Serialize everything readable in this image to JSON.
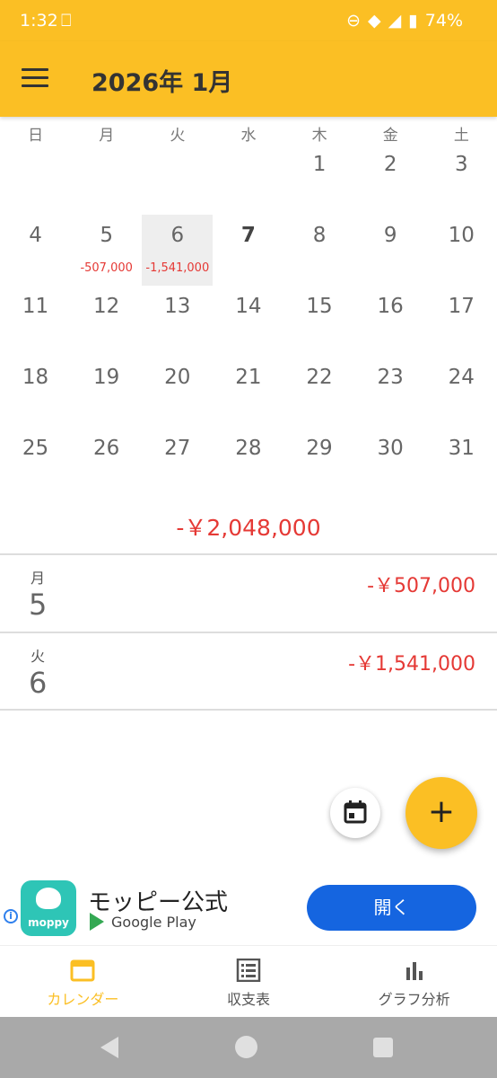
{
  "status": {
    "time": "1:32",
    "battery": "74%"
  },
  "appbar": {
    "title": "2026年 1月"
  },
  "calendar": {
    "weekdays": [
      "日",
      "月",
      "火",
      "水",
      "木",
      "金",
      "土"
    ],
    "weeks": [
      [
        {
          "d": ""
        },
        {
          "d": ""
        },
        {
          "d": ""
        },
        {
          "d": ""
        },
        {
          "d": "1"
        },
        {
          "d": "2"
        },
        {
          "d": "3"
        }
      ],
      [
        {
          "d": "4"
        },
        {
          "d": "5",
          "amt": "-507,000"
        },
        {
          "d": "6",
          "amt": "-1,541,000",
          "selected": true
        },
        {
          "d": "7",
          "today": true
        },
        {
          "d": "8"
        },
        {
          "d": "9"
        },
        {
          "d": "10"
        }
      ],
      [
        {
          "d": "11"
        },
        {
          "d": "12"
        },
        {
          "d": "13"
        },
        {
          "d": "14"
        },
        {
          "d": "15"
        },
        {
          "d": "16"
        },
        {
          "d": "17"
        }
      ],
      [
        {
          "d": "18"
        },
        {
          "d": "19"
        },
        {
          "d": "20"
        },
        {
          "d": "21"
        },
        {
          "d": "22"
        },
        {
          "d": "23"
        },
        {
          "d": "24"
        }
      ],
      [
        {
          "d": "25"
        },
        {
          "d": "26"
        },
        {
          "d": "27"
        },
        {
          "d": "28"
        },
        {
          "d": "29"
        },
        {
          "d": "30"
        },
        {
          "d": "31"
        }
      ]
    ],
    "total": "-￥2,048,000"
  },
  "entries": [
    {
      "weekday": "月",
      "day": "5",
      "amount": "-￥507,000"
    },
    {
      "weekday": "火",
      "day": "6",
      "amount": "-￥1,541,000"
    }
  ],
  "fab": {
    "add_label": "+"
  },
  "ad": {
    "app_name": "モッピー公式",
    "store": "Google Play",
    "logo_text": "moppy",
    "open_label": "開く"
  },
  "nav": {
    "items": [
      {
        "label": "カレンダー",
        "icon": "calendar-icon",
        "active": true
      },
      {
        "label": "収支表",
        "icon": "list-icon",
        "active": false
      },
      {
        "label": "グラフ分析",
        "icon": "bar-chart-icon",
        "active": false
      }
    ]
  },
  "colors": {
    "accent": "#fbbf24",
    "negative": "#e53935",
    "button": "#1565e0"
  }
}
